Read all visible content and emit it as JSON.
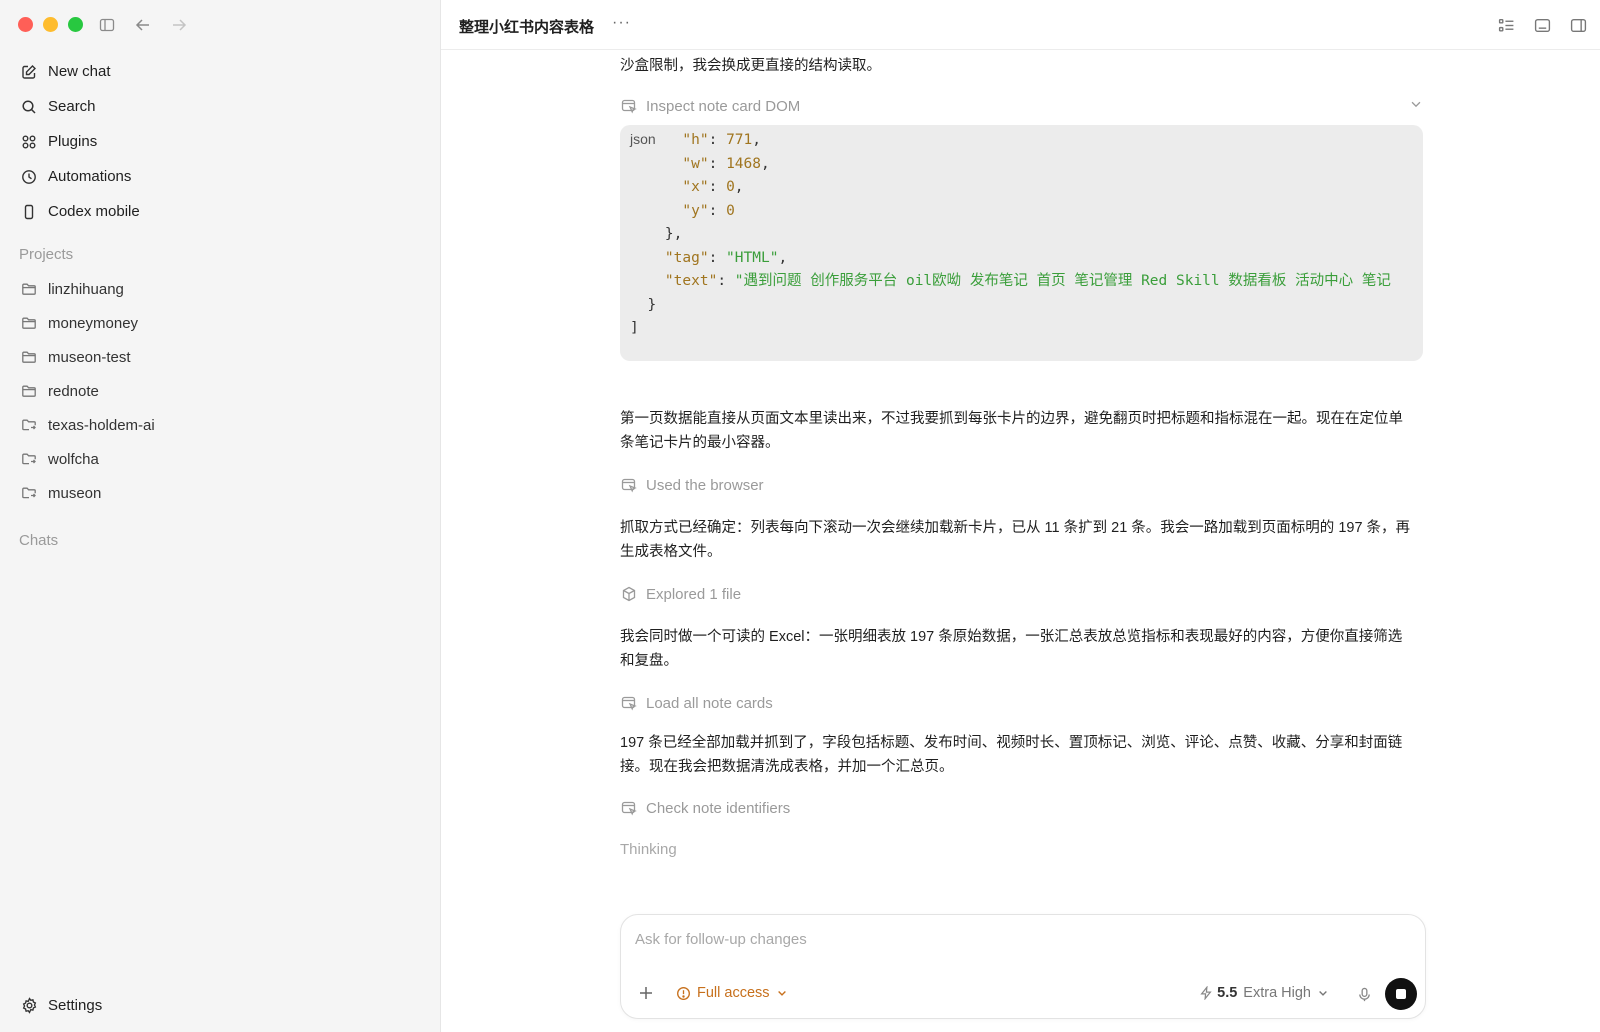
{
  "sidebar": {
    "nav": [
      {
        "label": "New chat",
        "icon": "edit-icon"
      },
      {
        "label": "Search",
        "icon": "search-icon"
      },
      {
        "label": "Plugins",
        "icon": "grid-icon"
      },
      {
        "label": "Automations",
        "icon": "clock-icon"
      },
      {
        "label": "Codex mobile",
        "icon": "phone-icon"
      }
    ],
    "projects_label": "Projects",
    "projects": [
      {
        "label": "linzhihuang",
        "icon": "folder-icon"
      },
      {
        "label": "moneymoney",
        "icon": "folder-icon"
      },
      {
        "label": "museon-test",
        "icon": "folder-icon"
      },
      {
        "label": "rednote",
        "icon": "folder-icon"
      },
      {
        "label": "texas-holdem-ai",
        "icon": "folder-linked-icon"
      },
      {
        "label": "wolfcha",
        "icon": "folder-linked-icon"
      },
      {
        "label": "museon",
        "icon": "folder-linked-icon"
      }
    ],
    "chats_label": "Chats",
    "settings_label": "Settings"
  },
  "header": {
    "title": "整理小红书内容表格",
    "more": "···"
  },
  "conversation": {
    "intro_text": "沙盒限制，我会换成更直接的结构读取。",
    "tool1": "Inspect note card DOM",
    "code_lang": "json",
    "code_lines": {
      "l0_key": "\"h\"",
      "l0_val": "771",
      "l1_key": "\"w\"",
      "l1_val": "1468",
      "l2_key": "\"x\"",
      "l2_val": "0",
      "l3_key": "\"y\"",
      "l3_val": "0",
      "l5_key": "\"tag\"",
      "l5_val": "\"HTML\"",
      "l6_key": "\"text\"",
      "l6_val": "\"遇到问题 创作服务平台 oil欧呦 发布笔记 首页 笔记管理 Red Skill 数据看板 活动中心 笔记"
    },
    "para1": "第一页数据能直接从页面文本里读出来，不过我要抓到每张卡片的边界，避免翻页时把标题和指标混在一起。现在在定位单条笔记卡片的最小容器。",
    "tool2": "Used the browser",
    "para2": "抓取方式已经确定：列表每向下滚动一次会继续加载新卡片，已从 11 条扩到 21 条。我会一路加载到页面标明的 197 条，再生成表格文件。",
    "tool3": "Explored 1 file",
    "para3": "我会同时做一个可读的 Excel：一张明细表放 197 条原始数据，一张汇总表放总览指标和表现最好的内容，方便你直接筛选和复盘。",
    "tool4": "Load all note cards",
    "para4": "197 条已经全部加载并抓到了，字段包括标题、发布时间、视频时长、置顶标记、浏览、评论、点赞、收藏、分享和封面链接。现在我会把数据清洗成表格，并加一个汇总页。",
    "tool5": "Check note identifiers",
    "thinking": "Thinking"
  },
  "composer": {
    "placeholder": "Ask for follow-up changes",
    "access_label": "Full access",
    "model_version": "5.5",
    "model_level": "Extra High"
  },
  "colors": {
    "sidebar_bg": "#f5f5f5",
    "access": "#c7701c",
    "code_bg": "#ececec",
    "code_key": "#a0751f",
    "code_string": "#3a9e3a"
  }
}
